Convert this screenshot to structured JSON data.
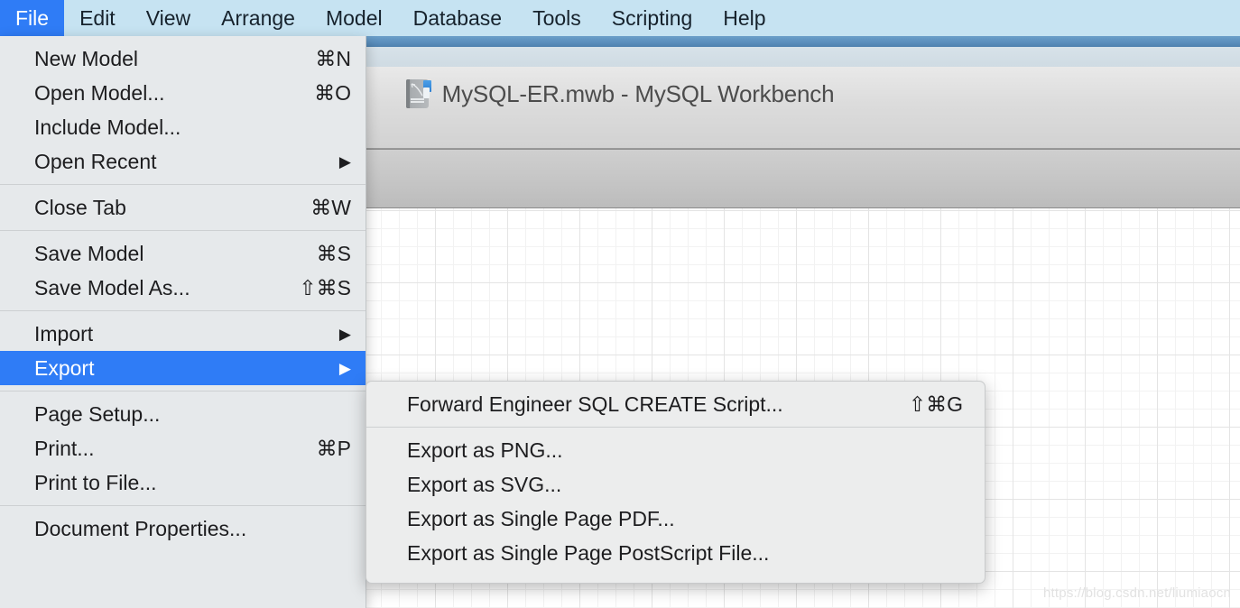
{
  "menubar": {
    "items": [
      {
        "label": "File",
        "active": true
      },
      {
        "label": "Edit",
        "active": false
      },
      {
        "label": "View",
        "active": false
      },
      {
        "label": "Arrange",
        "active": false
      },
      {
        "label": "Model",
        "active": false
      },
      {
        "label": "Database",
        "active": false
      },
      {
        "label": "Tools",
        "active": false
      },
      {
        "label": "Scripting",
        "active": false
      },
      {
        "label": "Help",
        "active": false
      }
    ]
  },
  "window": {
    "title": "MySQL-ER.mwb - MySQL Workbench",
    "doc_icon": "model-document-icon",
    "watermark": "https://blog.csdn.net/liumiaocn"
  },
  "file_menu": {
    "groups": [
      {
        "items": [
          {
            "label": "New Model",
            "shortcut": "⌘N",
            "arrow": "",
            "selected": false
          },
          {
            "label": "Open Model...",
            "shortcut": "⌘O",
            "arrow": "",
            "selected": false
          },
          {
            "label": "Include Model...",
            "shortcut": "",
            "arrow": "",
            "selected": false
          },
          {
            "label": "Open Recent",
            "shortcut": "",
            "arrow": "▶",
            "selected": false
          }
        ]
      },
      {
        "items": [
          {
            "label": "Close Tab",
            "shortcut": "⌘W",
            "arrow": "",
            "selected": false
          }
        ]
      },
      {
        "items": [
          {
            "label": "Save Model",
            "shortcut": "⌘S",
            "arrow": "",
            "selected": false
          },
          {
            "label": "Save Model As...",
            "shortcut": "⇧⌘S",
            "arrow": "",
            "selected": false
          }
        ]
      },
      {
        "items": [
          {
            "label": "Import",
            "shortcut": "",
            "arrow": "▶",
            "selected": false
          },
          {
            "label": "Export",
            "shortcut": "",
            "arrow": "▶",
            "selected": true
          }
        ]
      },
      {
        "items": [
          {
            "label": "Page Setup...",
            "shortcut": "",
            "arrow": "",
            "selected": false
          },
          {
            "label": "Print...",
            "shortcut": "⌘P",
            "arrow": "",
            "selected": false
          },
          {
            "label": "Print to File...",
            "shortcut": "",
            "arrow": "",
            "selected": false
          }
        ]
      },
      {
        "items": [
          {
            "label": "Document Properties...",
            "shortcut": "",
            "arrow": "",
            "selected": false
          }
        ]
      }
    ]
  },
  "export_submenu": {
    "groups": [
      {
        "items": [
          {
            "label": "Forward Engineer SQL CREATE Script...",
            "shortcut": "⇧⌘G",
            "arrow": "",
            "selected": false
          }
        ]
      },
      {
        "items": [
          {
            "label": "Export as PNG...",
            "shortcut": "",
            "arrow": "",
            "selected": false
          },
          {
            "label": "Export as SVG...",
            "shortcut": "",
            "arrow": "",
            "selected": false
          },
          {
            "label": "Export as Single Page PDF...",
            "shortcut": "",
            "arrow": "",
            "selected": false
          },
          {
            "label": "Export as Single Page PostScript File...",
            "shortcut": "",
            "arrow": "",
            "selected": false
          }
        ]
      }
    ]
  },
  "colors": {
    "menubar_bg": "#c6e3f2",
    "accent_blue": "#2f7cf6",
    "menu_bg": "#e6e9eb",
    "submenu_bg": "#eceded",
    "titlebar_blue": "#5b8fbd"
  }
}
